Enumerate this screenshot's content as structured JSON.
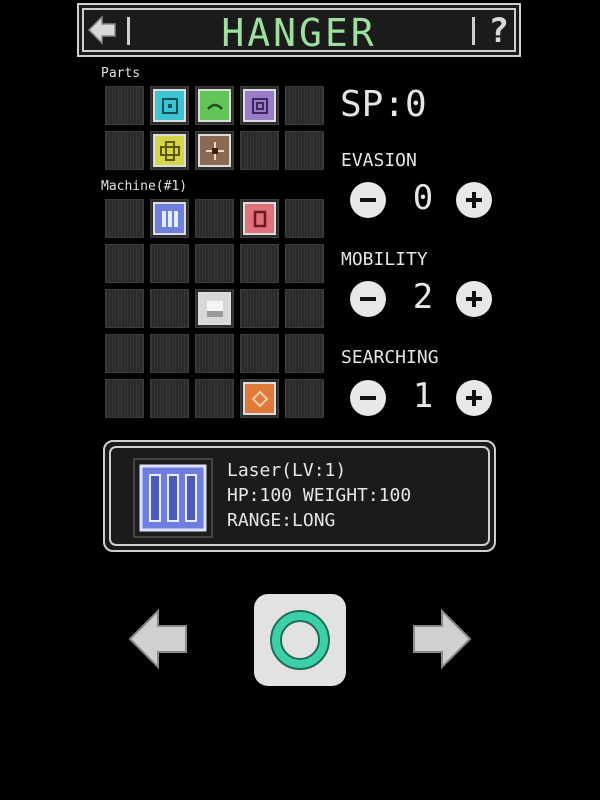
{
  "header": {
    "title": "HANGER",
    "back_icon": "back-arrow-icon",
    "help_label": "?"
  },
  "parts_label": "Parts",
  "machine_label": "Machine(#1)",
  "sp": "SP:0",
  "stats": [
    {
      "name": "EVASION",
      "value": "0"
    },
    {
      "name": "MOBILITY",
      "value": "2"
    },
    {
      "name": "SEARCHING",
      "value": "1"
    }
  ],
  "parts_grid": [
    [
      "empty",
      "cyan",
      "green",
      "purple",
      "empty"
    ],
    [
      "empty",
      "yellow",
      "brown",
      "empty",
      "empty"
    ]
  ],
  "machine_grid": [
    [
      "empty",
      "blue",
      "empty",
      "red",
      "empty"
    ],
    [
      "empty",
      "empty",
      "empty",
      "empty",
      "empty"
    ],
    [
      "empty",
      "empty",
      "white",
      "empty",
      "empty"
    ],
    [
      "empty",
      "empty",
      "empty",
      "empty",
      "empty"
    ],
    [
      "empty",
      "empty",
      "empty",
      "orange",
      "empty"
    ]
  ],
  "selected_part": {
    "name": "Laser(LV:1)",
    "stats": "HP:100 WEIGHT:100",
    "range": "RANGE:LONG"
  },
  "colors": {
    "title": "#9fe0a0",
    "cyan": "#3ec3d3",
    "green": "#63c45a",
    "purple": "#9a7cc8",
    "yellow": "#d5d54a",
    "brown": "#8a6a55",
    "blue": "#6f7fe0",
    "red": "#e0707a",
    "white": "#d8d8d8",
    "orange": "#e07a3a"
  }
}
